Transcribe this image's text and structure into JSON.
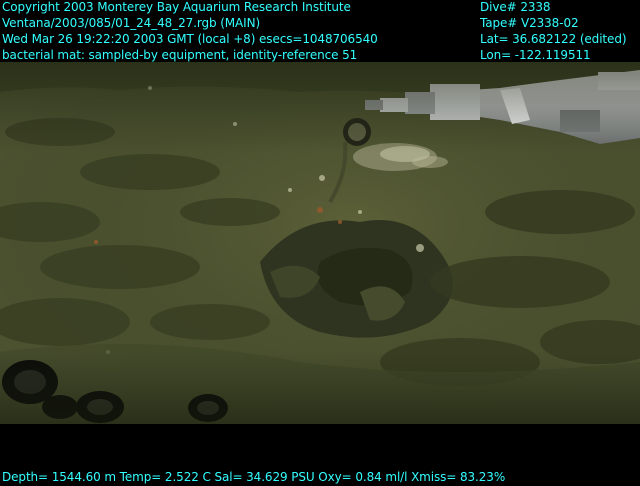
{
  "overlay": {
    "copyright": "Copyright 2003 Monterey Bay Aquarium Research Institute",
    "source": "Ventana/2003/085/01_24_48_27.rgb (MAIN)",
    "datetime": "Wed Mar 26 19:22:20 2003 GMT (local +8)  esecs=1048706540",
    "annotation": "bacterial mat: sampled-by equipment, identity-reference 51",
    "dive": "Dive# 2338",
    "tape": "Tape# V2338-02",
    "lat": "Lat= 36.682122 (edited)",
    "lon": "Lon= -122.119511",
    "telemetry": "Depth= 1544.60 m  Temp= 2.522 C  Sal= 34.629 PSU  Oxy= 0.84 ml/l  Xmiss= 83.23%"
  },
  "colors": {
    "overlay_text": "#33ffff",
    "sediment": "#4f5530",
    "rock": "#2b2f1a",
    "bacterial_mat": "#c8c7a6"
  }
}
